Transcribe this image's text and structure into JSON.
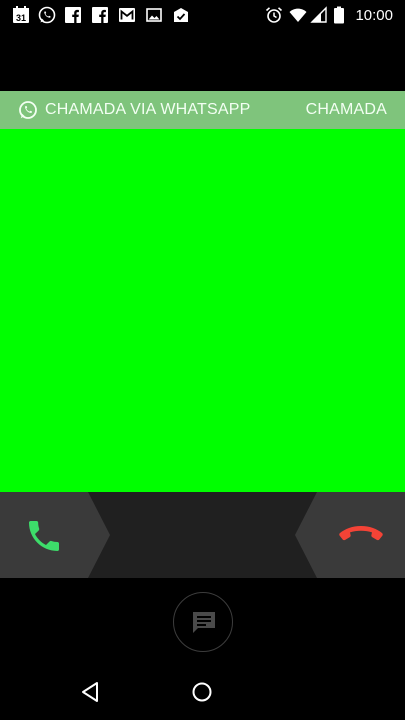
{
  "status_bar": {
    "time": "10:00",
    "calendar_day": "31",
    "notification_icons": [
      "calendar-icon",
      "whatsapp-icon",
      "facebook-icon",
      "facebook-icon",
      "gmail-icon",
      "image-icon",
      "task-icon"
    ],
    "system_icons": [
      "alarm-icon",
      "wifi-icon",
      "signal-icon",
      "battery-icon"
    ]
  },
  "header": {
    "app_label": "CHAMADA VIA WHATSAPP",
    "call_type": "CHAMADA",
    "background_color": "#7fc47c"
  },
  "caller": {
    "background_color": "#00ff00"
  },
  "actions": {
    "answer_icon": "phone-icon",
    "answer_color": "#3ddc6a",
    "decline_icon": "hang-up-icon",
    "decline_color": "#f44336",
    "message_icon": "message-icon"
  },
  "nav_bar": {
    "items": [
      "back-icon",
      "home-icon"
    ]
  }
}
